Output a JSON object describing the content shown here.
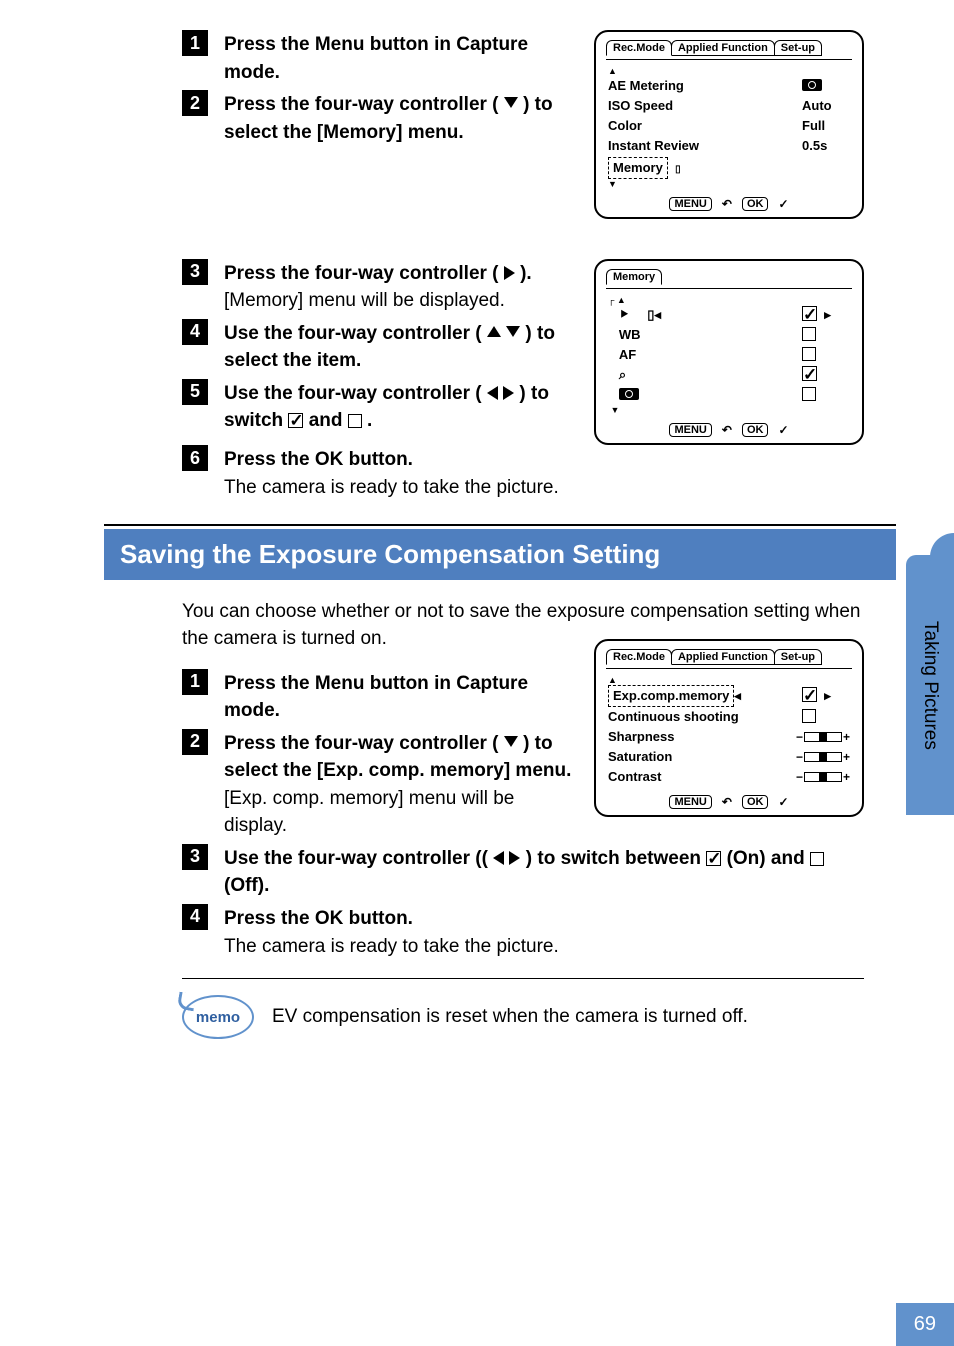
{
  "steps_top": [
    {
      "num": "1",
      "bold": "Press the Menu button in Capture mode."
    },
    {
      "num": "2",
      "bold_pre": "Press the four-way controller ( ",
      "bold_post": " ) to select the [Memory] menu."
    }
  ],
  "steps_mid": [
    {
      "num": "3",
      "bold_pre": "Press the four-way controller ( ",
      "bold_post": " ).",
      "body": "[Memory] menu will be displayed."
    },
    {
      "num": "4",
      "bold_pre": "Use the four-way controller ( ",
      "bold_post": " ) to select the item."
    },
    {
      "num": "5",
      "bold_pre": "Use the four-way controller ( ",
      "bold_post": " ) to switch ",
      "bold_tail": " and ",
      "bold_end": " ."
    },
    {
      "num": "6",
      "bold": "Press the OK button.",
      "body": "The camera is ready to take the picture."
    }
  ],
  "section_title": "Saving the Exposure Compensation Setting",
  "intro": "You can choose whether or not to save the exposure compensation setting when the camera is turned on.",
  "steps_bottom": [
    {
      "num": "1",
      "bold": "Press the Menu button in Capture mode."
    },
    {
      "num": "2",
      "bold_pre": "Press the four-way controller ( ",
      "bold_post": " ) to select the [Exp. comp. memory] menu.",
      "body": "[Exp. comp. memory] menu will be display."
    },
    {
      "num": "3",
      "bold_pre": "Use the four-way controller (( ",
      "bold_post": " ) to switch between ",
      "bold_mid": " (On) and ",
      "bold_end": " (Off)."
    },
    {
      "num": "4",
      "bold": "Press the OK button.",
      "body": "The camera is ready to take the picture."
    }
  ],
  "memo": "EV compensation is reset when the camera is turned off.",
  "memo_label": "memo",
  "side_tab": "Taking Pictures",
  "page_number": "69",
  "lcd1": {
    "tabs": [
      "Rec.Mode",
      "Applied Function",
      "Set-up"
    ],
    "rows": [
      {
        "lab": "AE Metering",
        "valIcon": "cam"
      },
      {
        "lab": "ISO Speed",
        "val": "Auto"
      },
      {
        "lab": "Color",
        "val": "Full"
      },
      {
        "lab": "Instant Review",
        "val": "0.5s"
      },
      {
        "lab": "Memory",
        "selected": true
      }
    ],
    "footer_menu": "MENU",
    "footer_ok": "OK"
  },
  "lcd2": {
    "title": "Memory",
    "rows": [
      {
        "icon": "⯈",
        "checked": true,
        "sel": true
      },
      {
        "lab": "WB",
        "checked": false
      },
      {
        "lab": "AF",
        "checked": false
      },
      {
        "icon": "🔍",
        "checked": true
      },
      {
        "icon": "cam",
        "checked": false
      }
    ],
    "footer_menu": "MENU",
    "footer_ok": "OK"
  },
  "lcd3": {
    "tabs": [
      "Rec.Mode",
      "Applied Function",
      "Set-up"
    ],
    "rows": [
      {
        "lab": "Exp.comp.memory",
        "checked": true,
        "sel": true
      },
      {
        "lab": "Continuous shooting",
        "checked": false
      },
      {
        "lab": "Sharpness",
        "slider": true
      },
      {
        "lab": "Saturation",
        "slider": true
      },
      {
        "lab": "Contrast",
        "slider": true
      }
    ],
    "footer_menu": "MENU",
    "footer_ok": "OK"
  }
}
